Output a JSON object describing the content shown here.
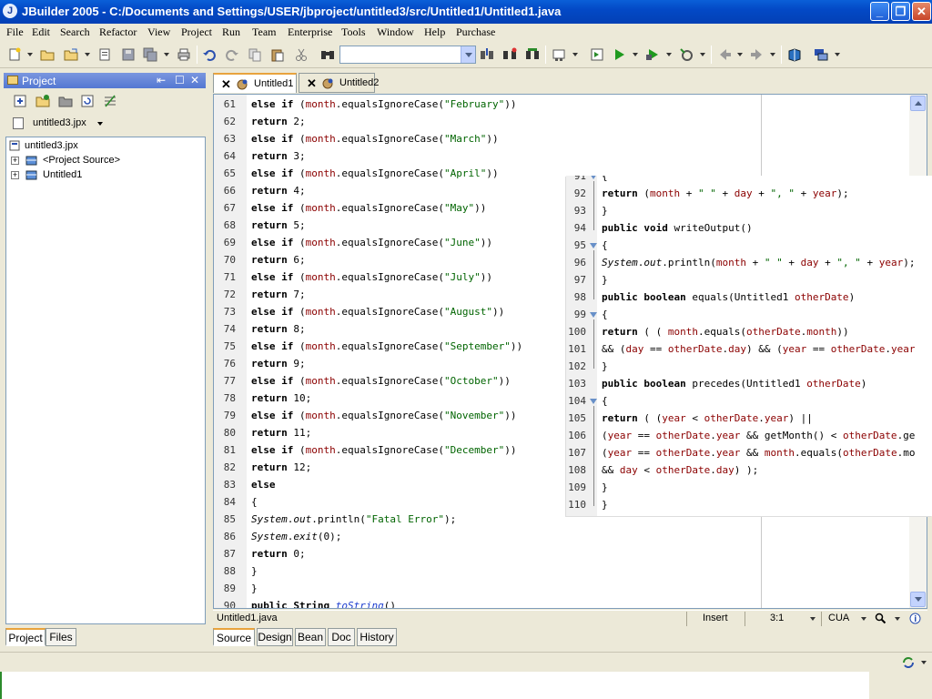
{
  "window": {
    "title": "JBuilder 2005 - C:/Documents and Settings/USER/jbproject/untitled3/src/Untitled1/Untitled1.java",
    "minimize": "_",
    "maximize": "❐",
    "close": "✕"
  },
  "menu": [
    "File",
    "Edit",
    "Search",
    "Refactor",
    "View",
    "Project",
    "Run",
    "Team",
    "Enterprise",
    "Tools",
    "Window",
    "Help",
    "Purchase"
  ],
  "project_panel": {
    "title": "Project",
    "controls": [
      "⇤",
      "☐",
      "✕"
    ],
    "selector": "untitled3.jpx",
    "tree": {
      "root": "untitled3.jpx",
      "children": [
        "<Project Source>",
        "Untitled1"
      ]
    },
    "tabs": [
      "Project",
      "Files"
    ]
  },
  "editor": {
    "tabs": [
      "Untitled1",
      "Untitled2"
    ],
    "main_lines": [
      {
        "n": "61",
        "code": "else if (month.equalsIgnoreCase(\"February\"))"
      },
      {
        "n": "62",
        "code": "return 2;"
      },
      {
        "n": "63",
        "code": "else if (month.equalsIgnoreCase(\"March\"))"
      },
      {
        "n": "64",
        "code": "return 3;"
      },
      {
        "n": "65",
        "code": "else if (month.equalsIgnoreCase(\"April\"))"
      },
      {
        "n": "66",
        "code": "return 4;"
      },
      {
        "n": "67",
        "code": "else if (month.equalsIgnoreCase(\"May\"))"
      },
      {
        "n": "68",
        "code": "return 5;"
      },
      {
        "n": "69",
        "code": "else if (month.equalsIgnoreCase(\"June\"))"
      },
      {
        "n": "70",
        "code": "return 6;"
      },
      {
        "n": "71",
        "code": "else if (month.equalsIgnoreCase(\"July\"))"
      },
      {
        "n": "72",
        "code": "return 7;"
      },
      {
        "n": "73",
        "code": "else if (month.equalsIgnoreCase(\"August\"))"
      },
      {
        "n": "74",
        "code": "return 8;"
      },
      {
        "n": "75",
        "code": "else if (month.equalsIgnoreCase(\"September\"))"
      },
      {
        "n": "76",
        "code": "return 9;"
      },
      {
        "n": "77",
        "code": "else if (month.equalsIgnoreCase(\"October\"))"
      },
      {
        "n": "78",
        "code": "return 10;"
      },
      {
        "n": "79",
        "code": "else if (month.equalsIgnoreCase(\"November\"))"
      },
      {
        "n": "80",
        "code": "return 11;"
      },
      {
        "n": "81",
        "code": "else if (month.equalsIgnoreCase(\"December\"))"
      },
      {
        "n": "82",
        "code": "return 12;"
      },
      {
        "n": "83",
        "code": "else"
      },
      {
        "n": "84",
        "code": "{"
      },
      {
        "n": "85",
        "code": "System.out.println(\"Fatal Error\");"
      },
      {
        "n": "86",
        "code": "System.exit(0);"
      },
      {
        "n": "87",
        "code": "return 0;"
      },
      {
        "n": "88",
        "code": "}"
      },
      {
        "n": "89",
        "code": "}"
      },
      {
        "n": "90",
        "code": "public String toString()"
      }
    ],
    "overlay_lines": [
      {
        "n": "91",
        "code": "{"
      },
      {
        "n": "92",
        "code": "return (month + \" \" + day + \", \" + year);"
      },
      {
        "n": "93",
        "code": "}"
      },
      {
        "n": "94",
        "code": "public void writeOutput()"
      },
      {
        "n": "95",
        "code": "{"
      },
      {
        "n": "96",
        "code": "System.out.println(month + \" \" + day + \", \" + year);"
      },
      {
        "n": "97",
        "code": "}"
      },
      {
        "n": "98",
        "code": "public boolean equals(Untitled1 otherDate)"
      },
      {
        "n": "99",
        "code": "{"
      },
      {
        "n": "100",
        "code": "return ( ( month.equals(otherDate.month))"
      },
      {
        "n": "101",
        "code": "&& (day == otherDate.day) && (year == otherDate.year"
      },
      {
        "n": "102",
        "code": "}"
      },
      {
        "n": "103",
        "code": "public boolean precedes(Untitled1 otherDate)"
      },
      {
        "n": "104",
        "code": "{"
      },
      {
        "n": "105",
        "code": "return ( (year < otherDate.year) ||"
      },
      {
        "n": "106",
        "code": "(year == otherDate.year && getMonth() < otherDate.ge"
      },
      {
        "n": "107",
        "code": "(year == otherDate.year && month.equals(otherDate.mo"
      },
      {
        "n": "108",
        "code": "&& day < otherDate.day) );"
      },
      {
        "n": "109",
        "code": "}"
      },
      {
        "n": "110",
        "code": "}"
      }
    ]
  },
  "status": {
    "file": "Untitled1.java",
    "mode": "Insert",
    "position": "3:1",
    "keymap": "CUA"
  },
  "view_tabs": [
    "Source",
    "Design",
    "Bean",
    "Doc",
    "History"
  ]
}
